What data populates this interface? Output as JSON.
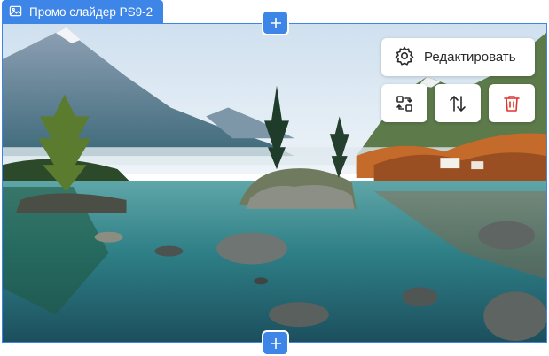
{
  "block": {
    "title": "Промо слайдер PS9-2",
    "accent_color": "#3d86e8",
    "icon": "image-icon"
  },
  "toolbar": {
    "edit_label": "Редактировать",
    "edit_icon": "gear-icon",
    "swap_icon": "swap-icon",
    "move_icon": "sort-arrows-icon",
    "delete_icon": "trash-icon",
    "delete_color": "#e0342b"
  },
  "add_buttons": {
    "icon": "plus-icon"
  }
}
